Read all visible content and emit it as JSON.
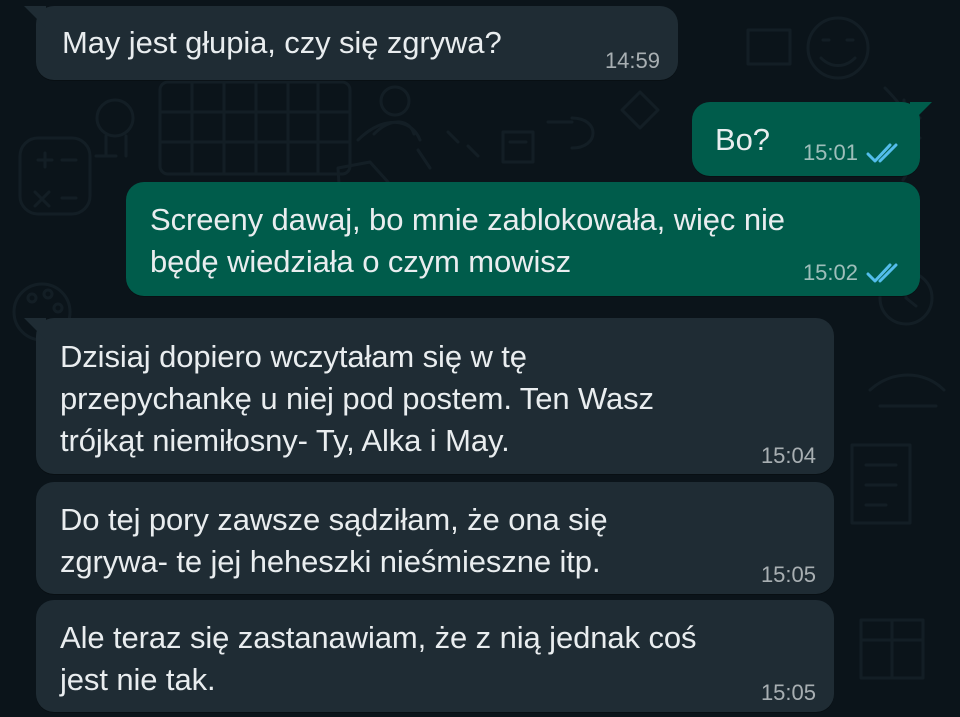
{
  "messages": [
    {
      "text": "May jest głupia, czy się zgrywa?",
      "time": "14:59",
      "status": ""
    },
    {
      "text": "Bo?",
      "time": "15:01",
      "status": "read"
    },
    {
      "text": "Screeny dawaj, bo mnie zablokowała, więc nie\nbędę wiedziała o czym mowisz",
      "time": "15:02",
      "status": "read"
    },
    {
      "text": "Dzisiaj dopiero wczytałam się w tę\nprzepychankę u niej pod postem. Ten Wasz\ntrójkąt niemiłosny- Ty, Alka i May.",
      "time": "15:04",
      "status": ""
    },
    {
      "text": "Do tej pory zawsze sądziłam, że ona się\nzgrywa- te jej heheszki nieśmieszne itp.",
      "time": "15:05",
      "status": ""
    },
    {
      "text": "Ale teraz się zastanawiam, że z nią jednak coś\njest nie tak.",
      "time": "15:05",
      "status": ""
    }
  ],
  "theme": {
    "background": "#0b141a",
    "incoming_bubble": "#1f2c34",
    "outgoing_bubble": "#005c4b",
    "read_receipt": "#53bdeb"
  },
  "icons": {
    "read_receipt": "double-check-icon"
  }
}
